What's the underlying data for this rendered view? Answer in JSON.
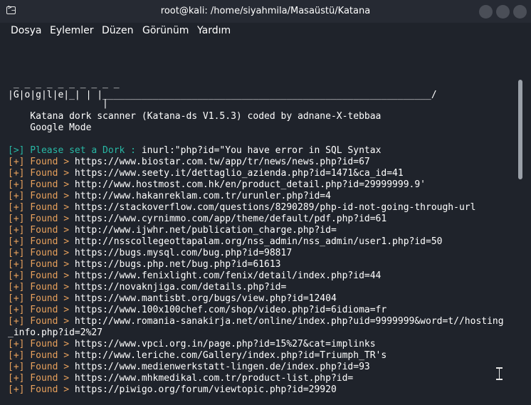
{
  "window": {
    "title": "root@kali: /home/siyahmila/Masaüstü/Katana"
  },
  "menu": [
    "Dosya",
    "Eylemler",
    "Düzen",
    "Görünüm",
    "Yardım"
  ],
  "banner": [
    " _ _ _ _ _ _ _ _ _ _ ",
    "|G|o|g|l|e|_| | |___________________________________________________________/",
    "                 |",
    "    Katana dork scanner (Katana-ds V1.5.3) coded by adnane-X-tebbaa",
    "    Google Mode"
  ],
  "prompt": {
    "prefix": "[>] Please set a Dork : ",
    "value": "inurl:\"php?id=\"You have error in SQL Syntax"
  },
  "found_prefix": "[+] Found > ",
  "results": [
    "https://www.biostar.com.tw/app/tr/news/news.php?id=67",
    "https://www.seety.it/dettaglio_azienda.php?id=1471&ca_id=41",
    "http://www.hostmost.com.hk/en/product_detail.php?id=29999999.9'",
    "http://www.hakanreklam.com.tr/urunler.php?id=4",
    "https://stackoverflow.com/questions/8290289/php-id-not-going-through-url",
    "https://www.cyrnimmo.com/app/theme/default/pdf.php?id=61",
    "http://www.ijwhr.net/publication_charge.php?id=",
    "http://nsscollegeottapalam.org/nss_admin/nss_admin/user1.php?id=50",
    "https://bugs.mysql.com/bug.php?id=98817",
    "https://bugs.php.net/bug.php?id=61613",
    "https://www.fenixlight.com/fenix/detail/index.php?id=44",
    "https://novaknjiga.com/details.php?id=",
    "https://www.mantisbt.org/bugs/view.php?id=12404",
    "https://www.100x100chef.com/shop/video.php?id=6idioma=fr",
    "http://www.romania-sanakirja.net/online/index.php?uid=9999999&word=t//hosting",
    "https://www.vpci.org.in/page.php?id=15%27&cat=implinks",
    "http://www.leriche.com/Gallery/index.php?id=Triumph_TR's",
    "https://www.medienwerkstatt-lingen.de/index.php?id=93",
    "https://www.mhkmedikal.com.tr/product-list.php?id=",
    "https://piwigo.org/forum/viewtopic.php?id=29920"
  ],
  "wrap_continuation": "_info.php?id=2%27"
}
